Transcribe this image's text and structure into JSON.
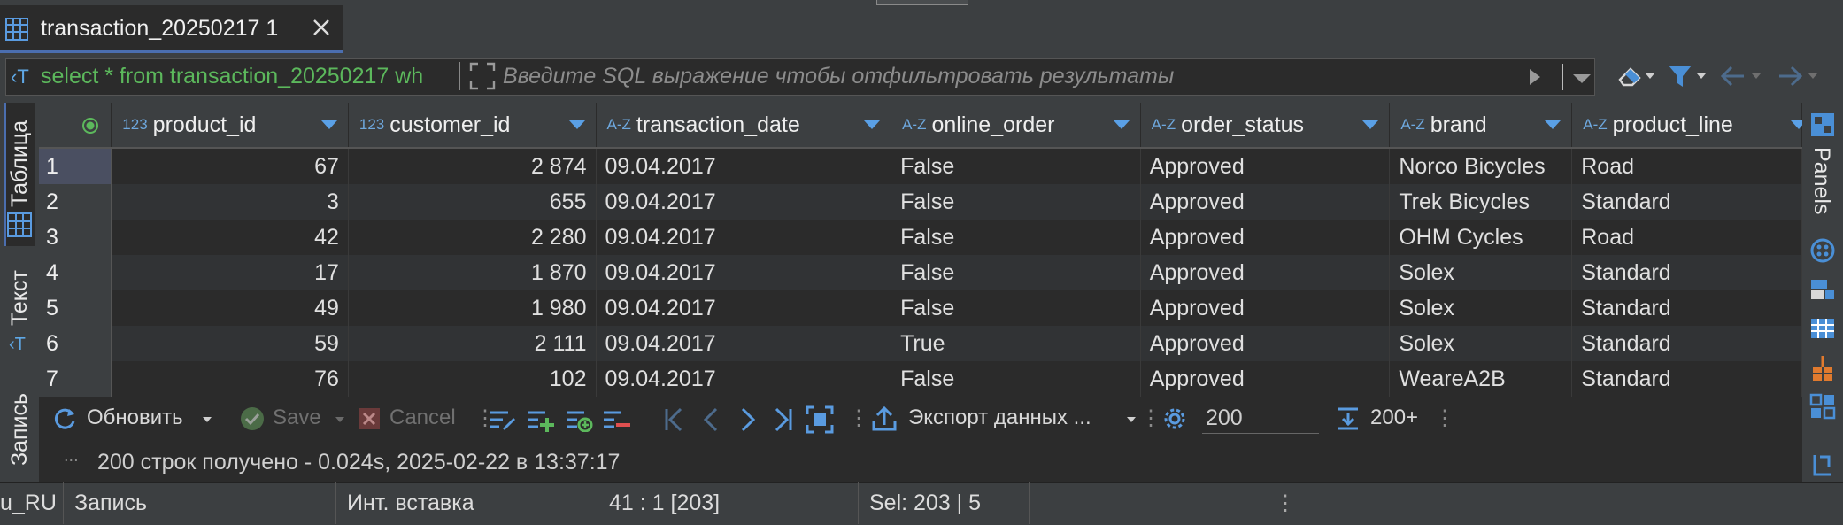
{
  "tab": {
    "title": "transaction_20250217 1"
  },
  "filter": {
    "sql": "select * from transaction_20250217 wh",
    "placeholder": "Введите SQL выражение чтобы отфильтровать результаты"
  },
  "left_tabs": {
    "table": "Таблица",
    "text": "Текст",
    "record": "Запись"
  },
  "right_tabs": {
    "panels": "Panels"
  },
  "grid": {
    "columns": [
      {
        "type": "123",
        "name": "product_id"
      },
      {
        "type": "A-Z",
        "name": "customer_id",
        "type_override": "123"
      },
      {
        "type": "A-Z",
        "name": "transaction_date"
      },
      {
        "type": "A-Z",
        "name": "online_order"
      },
      {
        "type": "A-Z",
        "name": "order_status"
      },
      {
        "type": "A-Z",
        "name": "brand"
      },
      {
        "type": "A-Z",
        "name": "product_line"
      }
    ],
    "rows": [
      {
        "n": "1",
        "cells": [
          "67",
          "2 874",
          "09.04.2017",
          "False",
          "Approved",
          "Norco Bicycles",
          "Road"
        ]
      },
      {
        "n": "2",
        "cells": [
          "3",
          "655",
          "09.04.2017",
          "False",
          "Approved",
          "Trek Bicycles",
          "Standard"
        ]
      },
      {
        "n": "3",
        "cells": [
          "42",
          "2 280",
          "09.04.2017",
          "False",
          "Approved",
          "OHM Cycles",
          "Road"
        ]
      },
      {
        "n": "4",
        "cells": [
          "17",
          "1 870",
          "09.04.2017",
          "False",
          "Approved",
          "Solex",
          "Standard"
        ]
      },
      {
        "n": "5",
        "cells": [
          "49",
          "1 980",
          "09.04.2017",
          "False",
          "Approved",
          "Solex",
          "Standard"
        ]
      },
      {
        "n": "6",
        "cells": [
          "59",
          "2 111",
          "09.04.2017",
          "True",
          "Approved",
          "Solex",
          "Standard"
        ]
      },
      {
        "n": "7",
        "cells": [
          "76",
          "102",
          "09.04.2017",
          "False",
          "Approved",
          "WeareA2B",
          "Standard"
        ]
      }
    ]
  },
  "toolbar": {
    "refresh": "Обновить",
    "save": "Save",
    "cancel": "Cancel",
    "export": "Экспорт данных ...",
    "fetch_size": "200",
    "fetch_more": "200+"
  },
  "status": "200 строк получено - 0.024s, 2025-02-22 в 13:37:17",
  "status_ellipsis": "...",
  "statusbar": {
    "locale": "u_RU",
    "mode": "Запись",
    "insert": "Инт. вставка",
    "position": "41 : 1 [203]",
    "sel": "Sel: 203 | 5"
  }
}
